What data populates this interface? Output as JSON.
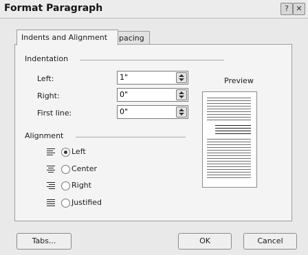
{
  "window": {
    "title": "Format Paragraph",
    "help_glyph": "?",
    "close_glyph": "✕"
  },
  "tabs": [
    {
      "label": "Indents and Alignment",
      "active": true
    },
    {
      "label": "Spacing",
      "active": false
    }
  ],
  "indentation": {
    "group_label": "Indentation",
    "fields": [
      {
        "label": "Left:",
        "value": "1\""
      },
      {
        "label": "Right:",
        "value": "0\""
      },
      {
        "label": "First line:",
        "value": "0\""
      }
    ]
  },
  "preview": {
    "label": "Preview"
  },
  "alignment": {
    "group_label": "Alignment",
    "options": [
      {
        "label": "Left",
        "icon": "align-left-icon",
        "checked": true
      },
      {
        "label": "Center",
        "icon": "align-center-icon",
        "checked": false
      },
      {
        "label": "Right",
        "icon": "align-right-icon",
        "checked": false
      },
      {
        "label": "Justified",
        "icon": "align-justify-icon",
        "checked": false
      }
    ]
  },
  "buttons": {
    "tabs": "Tabs...",
    "ok": "OK",
    "cancel": "Cancel"
  }
}
